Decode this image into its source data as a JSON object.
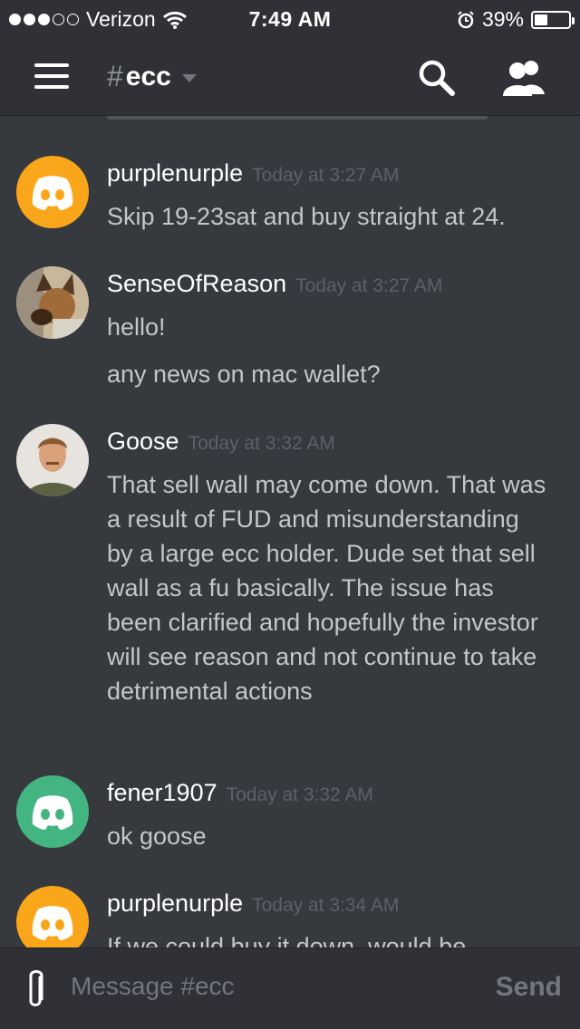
{
  "status_bar": {
    "carrier": "Verizon",
    "time": "7:49 AM",
    "battery": "39%",
    "battery_level": 0.39,
    "signal_bars_filled": 3,
    "signal_bars_total": 5
  },
  "header": {
    "hash": "#",
    "channel": "ecc",
    "icons": [
      "menu-icon",
      "chevron-down-icon",
      "search-icon",
      "members-icon"
    ]
  },
  "messages": [
    {
      "author": "purplenurple",
      "time": "Today at 3:27 AM",
      "avatar": "discord-logo-yellow",
      "lines": [
        "Skip 19-23sat and buy straight at 24."
      ]
    },
    {
      "author": "SenseOfReason",
      "time": "Today at 3:27 AM",
      "avatar": "dog-photo",
      "lines": [
        "hello!",
        "any news on mac wallet?"
      ]
    },
    {
      "author": "Goose",
      "time": "Today at 3:32 AM",
      "avatar": "man-photo",
      "lines": [
        "That sell wall may come down. That was a result of FUD and misunderstanding by a large ecc holder. Dude set that sell wall as a fu basically. The issue has been clarified and hopefully the investor will see reason and not continue to take detrimental actions"
      ]
    },
    {
      "author": "fener1907",
      "time": "Today at 3:32 AM",
      "avatar": "discord-logo-green",
      "lines": [
        "ok goose"
      ]
    },
    {
      "author": "purplenurple",
      "time": "Today at 3:34 AM",
      "avatar": "discord-logo-yellow",
      "lines": [
        "If we could buy it down, would be"
      ]
    }
  ],
  "composer": {
    "placeholder": "Message #ecc",
    "send_label": "Send"
  },
  "colors": {
    "background": "#36393e",
    "bar": "#2f3136",
    "yellow_avatar": "#faa61a",
    "green_avatar": "#43b581"
  }
}
